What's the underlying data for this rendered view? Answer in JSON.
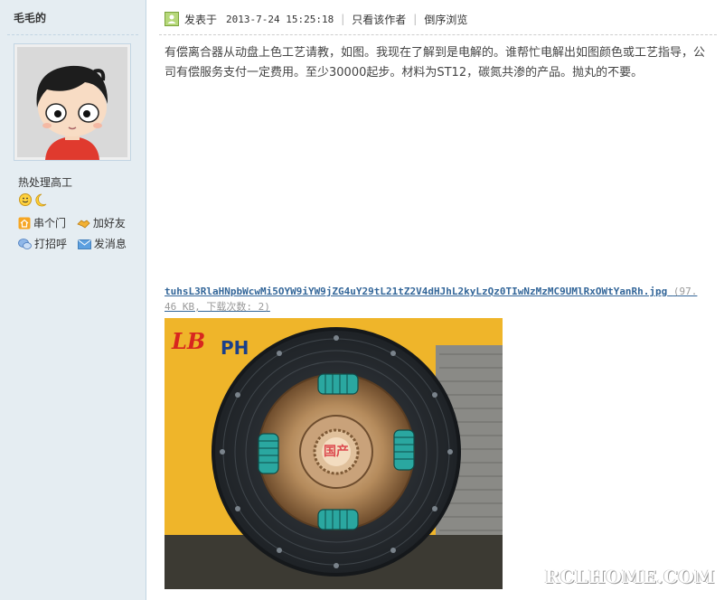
{
  "user": {
    "name": "毛毛的",
    "title": "热处理高工",
    "links": {
      "visit": "串个门",
      "add_friend": "加好友",
      "poke": "打招呼",
      "message": "发消息"
    }
  },
  "post": {
    "posted_label": "发表于",
    "date": "2013-7-24 15:25:18",
    "only_author": "只看该作者",
    "reverse": "倒序浏览",
    "body": "有偿离合器从动盘上色工艺请教，如图。我现在了解到是电解的。谁帮忙电解出如图颜色或工艺指导，公司有偿服务支付一定费用。至少30000起步。材料为ST12，碳氮共渗的产品。抛丸的不要。",
    "attachment": {
      "filename": "tuhsL3RlaHNpbWcwMi5OYW9iYW9jZG4uY29tL21tZ2V4dHJhL2kyLzQz0TIwNzMzMC9UMlRxOWtYanRh.jpg",
      "meta": "(97.46 KB, 下载次数: 2)"
    }
  },
  "photo_text": {
    "logo": "LB",
    "brand": "PH",
    "center_mark": "国产"
  },
  "watermark": "RCLHOME.COM",
  "colors": {
    "sidebar_bg": "#e5edf2",
    "border": "#c2d5e3",
    "link": "#336699"
  }
}
